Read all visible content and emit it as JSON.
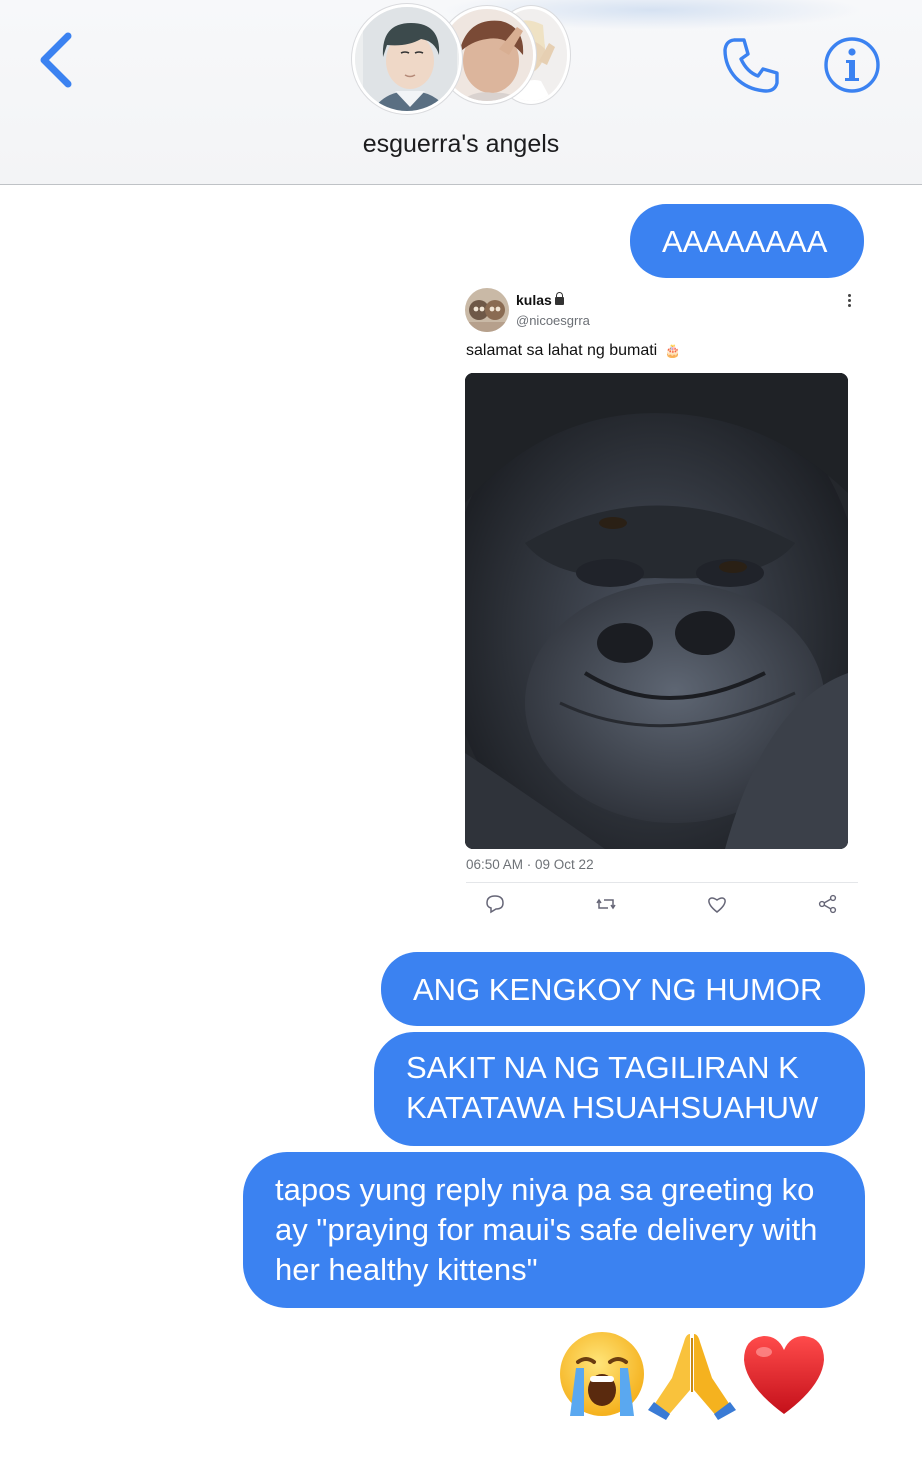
{
  "header": {
    "group_name": "esguerra's angels",
    "back_icon": "chevron-left-icon",
    "call_icon": "phone-icon",
    "info_icon": "info-icon",
    "accent_color": "#3b82f1"
  },
  "messages": [
    {
      "type": "text",
      "text": "AAAAAAAA"
    },
    {
      "type": "tweet"
    },
    {
      "type": "text",
      "text": "ANG KENGKOY NG HUMOR"
    },
    {
      "type": "text",
      "lines": [
        "SAKIT NA NG TAGILIRAN K",
        "KATATAWA HSUAHSUAHUW"
      ]
    },
    {
      "type": "text",
      "lines": [
        "tapos yung reply niya pa sa greeting ko",
        "ay \"praying for maui's safe delivery with",
        "her healthy kittens\""
      ]
    },
    {
      "type": "emoji",
      "emojis": [
        "loudly-crying-face",
        "folded-hands",
        "red-heart"
      ]
    }
  ],
  "tweet": {
    "name": "kulas",
    "handle": "@nicoesgrra",
    "text": "salamat sa lahat ng bumati",
    "emoji": "🎂",
    "timestamp": "06:50 AM · 09 Oct 22",
    "photo_subject": "gorilla-photo",
    "actions": [
      "reply-icon",
      "retweet-icon",
      "like-icon",
      "share-icon"
    ]
  }
}
